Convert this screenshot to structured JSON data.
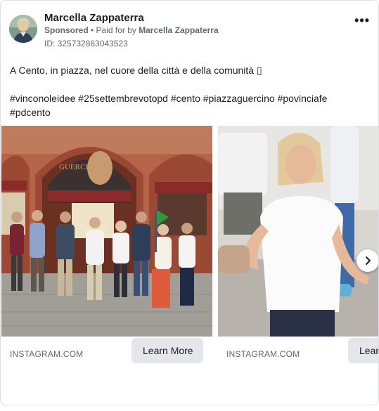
{
  "post": {
    "author": "Marcella Zappaterra",
    "sponsored": "Sponsored",
    "paid_prefix": " • Paid for by ",
    "paid_by": "Marcella Zappaterra",
    "library_id": "ID: 325732863043523",
    "text_line": "A Cento, in piazza, nel cuore della città e della comunità ▯",
    "hashtags": "#vinconoleidee #25settembrevotopd #cento #piazzaguercino #povinciafe #pdcento",
    "more_icon": "more-horizontal-icon"
  },
  "carousel": {
    "slides": [
      {
        "domain": "INSTAGRAM.COM",
        "cta": "Learn More",
        "sign_text": "GUERCINO"
      },
      {
        "domain": "INSTAGRAM.COM",
        "cta": "Learn More"
      }
    ],
    "next_icon": "chevron-right-icon"
  },
  "colors": {
    "secondary_text": "#65676b",
    "button_bg": "#e4e6eb",
    "border": "#dddfe2"
  }
}
